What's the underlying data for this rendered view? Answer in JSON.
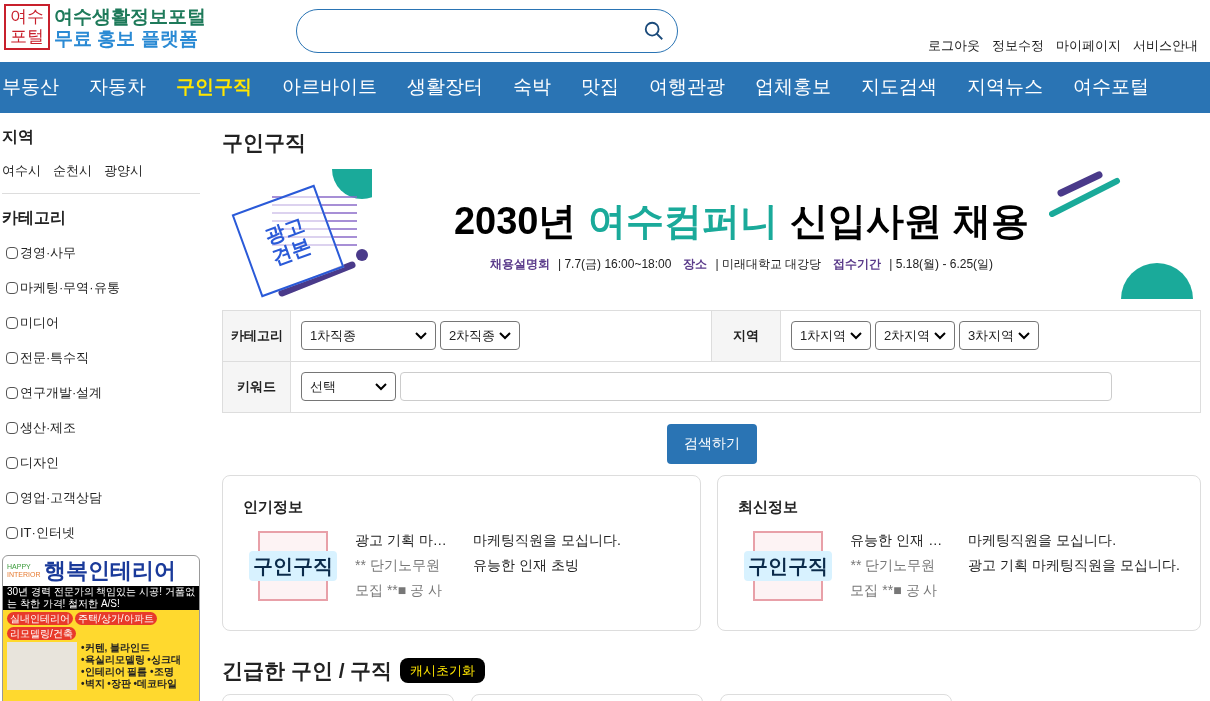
{
  "logo": {
    "mark": [
      "여수",
      "포털"
    ],
    "line_1": "여수생활정보포털",
    "line_2": "무료 홍보 플랫폼"
  },
  "user_links": [
    "로그아웃",
    "정보수정",
    "마이페이지",
    "서비스안내"
  ],
  "nav": [
    {
      "label": "부동산",
      "selected": false
    },
    {
      "label": "자동차",
      "selected": false
    },
    {
      "label": "구인구직",
      "selected": true
    },
    {
      "label": "아르바이트",
      "selected": false
    },
    {
      "label": "생활장터",
      "selected": false
    },
    {
      "label": "숙박",
      "selected": false
    },
    {
      "label": "맛집",
      "selected": false
    },
    {
      "label": "여행관광",
      "selected": false
    },
    {
      "label": "업체홍보",
      "selected": false
    },
    {
      "label": "지도검색",
      "selected": false
    },
    {
      "label": "지역뉴스",
      "selected": false
    },
    {
      "label": "여수포털",
      "selected": false
    }
  ],
  "sidebar": {
    "region_title": "지역",
    "regions": [
      "여수시",
      "순천시",
      "광양시"
    ],
    "category_title": "카테고리",
    "categories": [
      {
        "label": "경영·사무",
        "checked": false
      },
      {
        "label": "마케팅·무역·유통",
        "checked": false
      },
      {
        "label": "미디어",
        "checked": false
      },
      {
        "label": "전문·특수직",
        "checked": false
      },
      {
        "label": "연구개발·설계",
        "checked": false
      },
      {
        "label": "생산·제조",
        "checked": false
      },
      {
        "label": "디자인",
        "checked": false
      },
      {
        "label": "영업·고객상담",
        "checked": false
      },
      {
        "label": "IT·인터넷",
        "checked": false
      }
    ],
    "ad": {
      "brand_small": [
        "HAPPY",
        "INTERIOR"
      ],
      "brand": "행복인테리어",
      "tagline": "30년 경력 전문가의 책임있는 시공!  거품없는 착한 가격!  철저한 A/S!",
      "tags": [
        "실내인테리어",
        "주택/상가/아파트",
        "리모델링/건축"
      ],
      "bullets": [
        "•커텐, 블라인드",
        "•욕실리모델링  •싱크대",
        "•인테리어 필름  •조명",
        "•벽지  •장판  •데코타일"
      ]
    }
  },
  "page_title": "구인구직",
  "banner": {
    "separator": "|",
    "stamp": [
      "광고",
      "견본"
    ],
    "headline_1": "2030년",
    "headline_accent": "여수컴퍼니",
    "headline_2": "신입사원 채용",
    "details": [
      {
        "label": "채용설명회",
        "value": "7.7(금) 16:00~18:00"
      },
      {
        "label": "장소",
        "value": "미래대학교 대강당"
      },
      {
        "label": "접수기간",
        "value": "5.18(월) - 6.25(일)"
      }
    ]
  },
  "filters": {
    "category_label": "카테고리",
    "category_selects": [
      "1차직종",
      "2차직종"
    ],
    "region_label": "지역",
    "region_selects": [
      "1차지역",
      "2차지역",
      "3차지역"
    ],
    "keyword_label": "키워드",
    "keyword_select": "선택"
  },
  "search_button": "검색하기",
  "panels": [
    {
      "title": "인기정보",
      "thumb_label": "구인구직",
      "item_title": "광고 기획 마…",
      "item_meta": [
        "** 단기노무원",
        "모집 **■ 공 사"
      ],
      "links": [
        "마케팅직원을 모십니다.",
        "유능한 인재 초빙"
      ]
    },
    {
      "title": "최신정보",
      "thumb_label": "구인구직",
      "item_title": "유능한 인재 …",
      "item_meta": [
        "** 단기노무원",
        "모집 **■ 공 사"
      ],
      "links": [
        "마케팅직원을 모십니다.",
        "광고 기획 마케팅직원을 모십니다."
      ]
    }
  ],
  "urgent": {
    "title": "긴급한 구인 / 구직",
    "badge": "캐시초기화"
  }
}
